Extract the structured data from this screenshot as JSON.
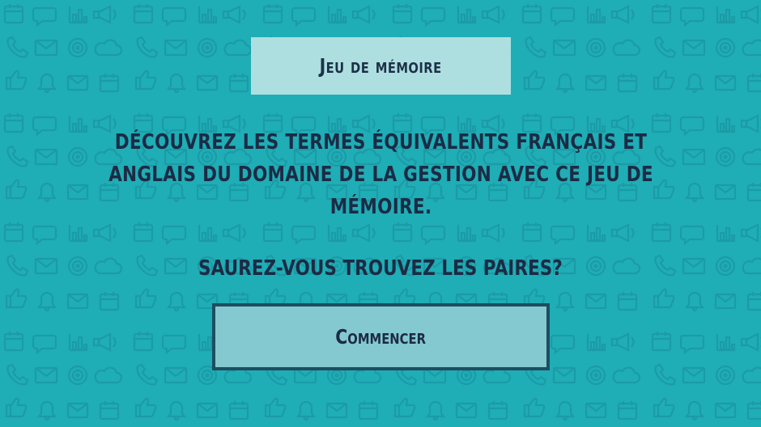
{
  "game": {
    "title": "Jeu de mémoire",
    "description": "Découvrez les termes équivalents français et anglais du domaine de la gestion avec ce jeu de mémoire.",
    "question": "Saurez-vous trouvez les paires?",
    "start_button_label": "Commencer"
  },
  "colors": {
    "background": "#1fadb6",
    "pattern_icons": "#1a98a1",
    "title_box": "#b6e2e3",
    "button_fill": "#84c9cf",
    "button_border": "#1e4d60",
    "text": "#1c2b44"
  },
  "background_icons": [
    "calendar-icon",
    "phone-icon",
    "speech-bubble-icon",
    "envelope-icon",
    "bell-icon",
    "thumbs-up-icon",
    "bar-chart-icon",
    "megaphone-icon",
    "cloud-icon",
    "target-icon"
  ]
}
